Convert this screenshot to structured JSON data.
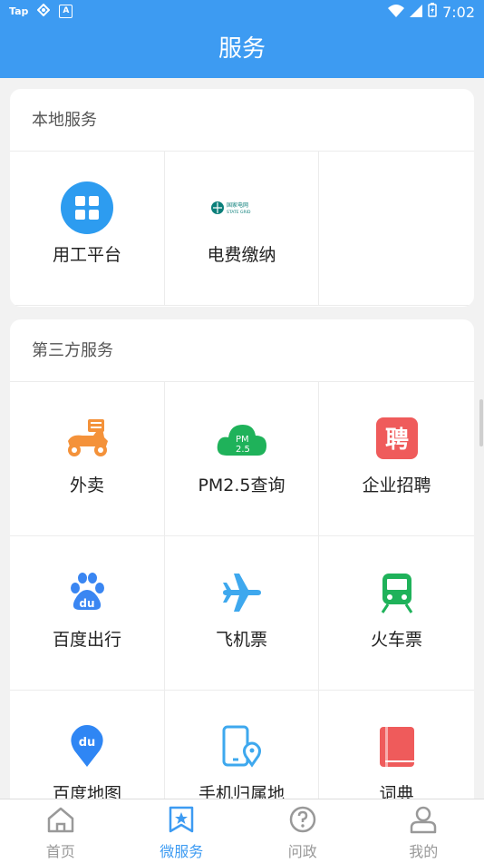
{
  "status_bar": {
    "left_items": [
      "Tap",
      "A"
    ],
    "time": "7:02"
  },
  "header": {
    "title": "服务"
  },
  "local": {
    "title": "本地服务",
    "items": [
      {
        "label": "用工平台",
        "icon": "grid-app-icon"
      },
      {
        "label": "电费缴纳",
        "icon": "state-grid-logo-icon",
        "logo_text": [
          "国家电网",
          "STATE GRID"
        ]
      }
    ]
  },
  "third_party": {
    "title": "第三方服务",
    "items": [
      {
        "label": "外卖",
        "icon": "delivery-scooter-icon"
      },
      {
        "label": "PM2.5查询",
        "icon": "pm25-cloud-icon",
        "icon_text": [
          "PM",
          "2.5"
        ]
      },
      {
        "label": "企业招聘",
        "icon": "recruit-icon",
        "icon_text": "聘"
      },
      {
        "label": "百度出行",
        "icon": "baidu-paw-icon",
        "icon_text": "du"
      },
      {
        "label": "飞机票",
        "icon": "airplane-icon"
      },
      {
        "label": "火车票",
        "icon": "train-icon"
      },
      {
        "label": "百度地图",
        "icon": "map-pin-icon",
        "icon_text": "du"
      },
      {
        "label": "手机归属地",
        "icon": "phone-location-icon"
      },
      {
        "label": "词典",
        "icon": "dictionary-book-icon"
      }
    ]
  },
  "tabs": [
    {
      "label": "首页",
      "icon": "home-icon",
      "active": false
    },
    {
      "label": "微服务",
      "icon": "star-bookmark-icon",
      "active": true
    },
    {
      "label": "问政",
      "icon": "question-icon",
      "active": false
    },
    {
      "label": "我的",
      "icon": "user-icon",
      "active": false
    }
  ],
  "colors": {
    "primary": "#3d9bf2",
    "orange": "#f4923a",
    "green": "#1fb25a",
    "red": "#ef5b5b",
    "blue": "#3a86f2",
    "airplane": "#3ea8ee"
  }
}
